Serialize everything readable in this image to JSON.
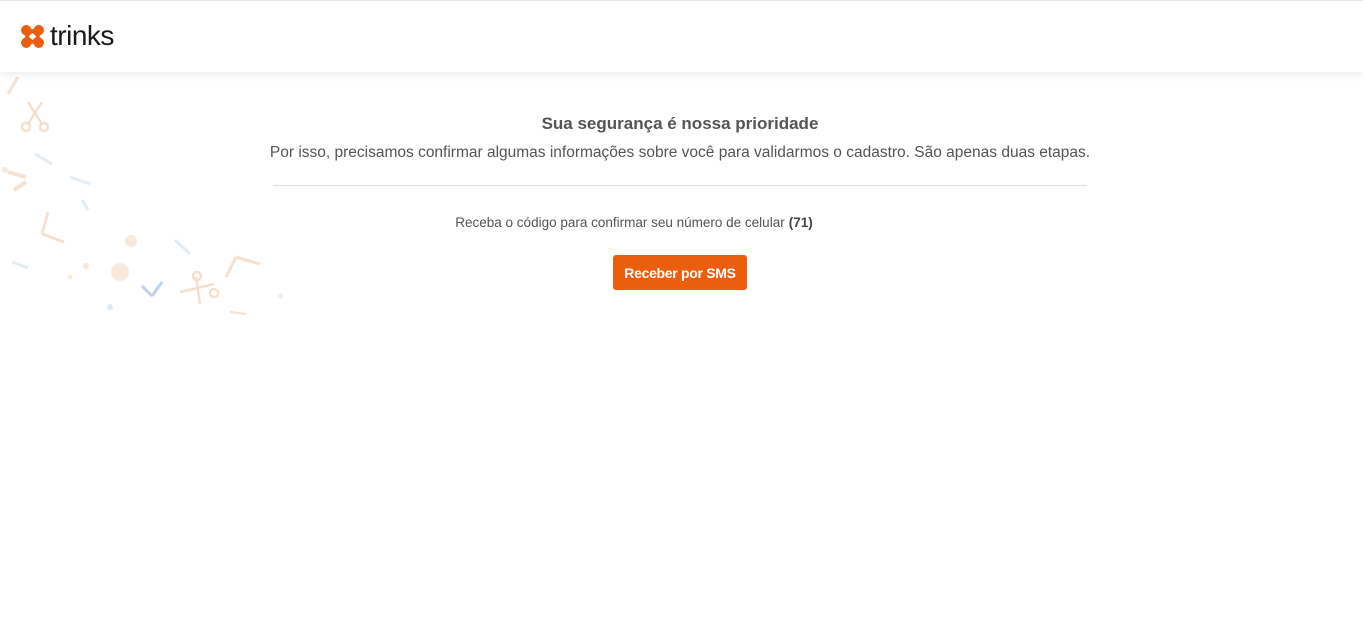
{
  "brand": {
    "name": "trinks",
    "accent_color": "#ea5e0e",
    "logo_icon": "four-petal-logo-icon"
  },
  "security": {
    "title": "Sua segurança é nossa prioridade",
    "subtitle": "Por isso, precisamos confirmar algumas informações sobre você para validarmos o cadastro. São apenas duas etapas."
  },
  "verification": {
    "instruction": "Receba o código para confirmar seu número de celular",
    "phone_code": "(71)",
    "sms_button_label": "Receber por SMS"
  },
  "decoration": {
    "icons": [
      "scissors-icon",
      "comb-icon",
      "confetti-icon"
    ]
  }
}
